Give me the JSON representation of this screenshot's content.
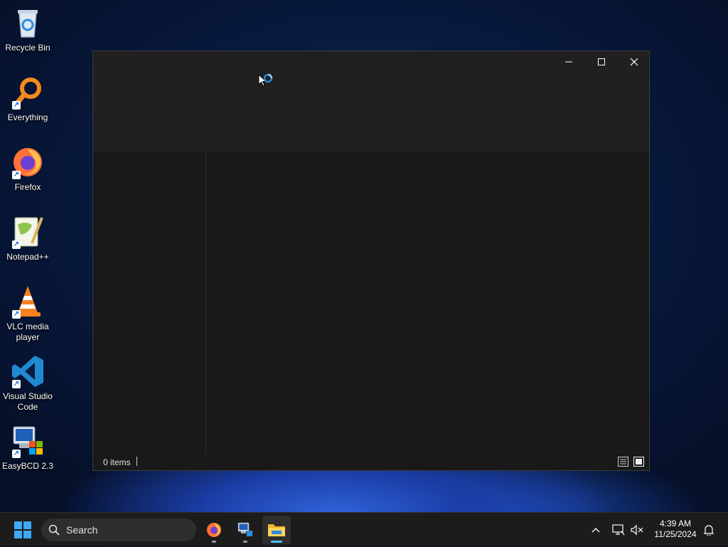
{
  "desktop": {
    "icons": [
      {
        "label": "Recycle Bin",
        "icon": "recycle-bin-icon"
      },
      {
        "label": "Everything",
        "icon": "everything-icon"
      },
      {
        "label": "Firefox",
        "icon": "firefox-icon"
      },
      {
        "label": "Notepad++",
        "icon": "notepad-plus-plus-icon"
      },
      {
        "label": "VLC media player",
        "icon": "vlc-icon"
      },
      {
        "label": "Visual Studio Code",
        "icon": "vscode-icon"
      },
      {
        "label": "EasyBCD 2.3",
        "icon": "easybcd-icon"
      }
    ]
  },
  "window": {
    "status_text": "0 items",
    "loading_icon": "loading-spinner-icon",
    "controls": [
      "minimize-icon",
      "maximize-icon",
      "close-icon"
    ]
  },
  "taskbar": {
    "search_placeholder": "Search",
    "apps": [
      "firefox-icon",
      "easybcd-icon",
      "file-explorer-icon"
    ],
    "active_app": "file-explorer",
    "clock": {
      "time": "4:39 AM",
      "date": "11/25/2024"
    }
  },
  "colors": {
    "accent": "#4cc2ff",
    "window_bg": "#191919",
    "titlebar_bg": "#202020",
    "taskbar_bg": "#1c1c1c"
  }
}
